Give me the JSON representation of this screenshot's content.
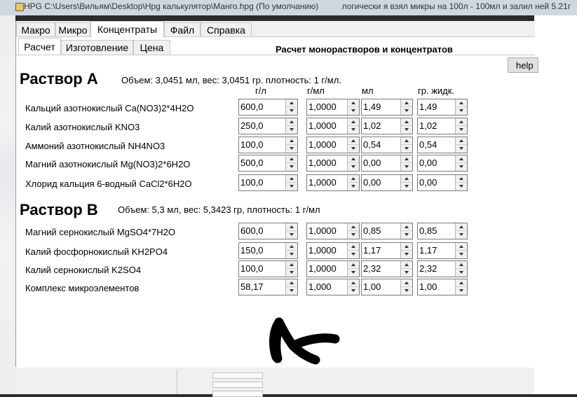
{
  "window_title": "HPG C:\\Users\\Вильям\\Desktop\\Hpg калькулятор\\Манго.hpg (По умолчанию)",
  "background_text": "логически я взял микры на 100л - 100мл и залил ней 5.21г",
  "menu": {
    "items": [
      "Макро",
      "Микро",
      "Концентраты",
      "Файл",
      "Справка"
    ],
    "active": 2
  },
  "subtabs": {
    "items": [
      "Расчет",
      "Изготовление",
      "Цена"
    ],
    "active": 0
  },
  "page_title": "Расчет монорастворов и концентратов",
  "help_label": "help",
  "columns": [
    "г/л",
    "г/мл",
    "мл",
    "гр. жидк."
  ],
  "solutions": [
    {
      "title": "Раствор А",
      "info": "Объем: 3,0451 мл, вес: 3,0451 гр. плотность: 1 г/мл.",
      "rows": [
        {
          "label": "Кальций азотнокислый Ca(NO3)2*4H2O",
          "values": [
            "600,0",
            "1,0000",
            "1,49",
            "1,49"
          ]
        },
        {
          "label": "Калий азотнокислый KNO3",
          "values": [
            "250,0",
            "1,0000",
            "1,02",
            "1,02"
          ]
        },
        {
          "label": "Аммоний азотнокислый NH4NO3",
          "values": [
            "100,0",
            "1,0000",
            "0,54",
            "0,54"
          ]
        },
        {
          "label": "Магний азотнокислый Mg(NO3)2*6H2O",
          "values": [
            "500,0",
            "1,0000",
            "0,00",
            "0,00"
          ]
        },
        {
          "label": "Хлорид кальция 6-водный CaCl2*6H2O",
          "values": [
            "100,0",
            "1,0000",
            "0,00",
            "0,00"
          ]
        }
      ]
    },
    {
      "title": "Раствор B",
      "info": "Объем: 5,3 мл, вес: 5,3423 гр, плотность: 1 г/мл",
      "rows": [
        {
          "label": "Магний сернокислый MgSO4*7H2O",
          "values": [
            "600,0",
            "1,0000",
            "0,85",
            "0,85"
          ]
        },
        {
          "label": "Калий фосфорнокислый KH2PO4",
          "values": [
            "150,0",
            "1,0000",
            "1,17",
            "1,17"
          ]
        },
        {
          "label": "Калий сернокислый K2SO4",
          "values": [
            "100,0",
            "1,0000",
            "2,32",
            "2,32"
          ]
        },
        {
          "label": "Комплекс микроэлементов",
          "values": [
            "58,17",
            "1,000",
            "1,00",
            "1,00"
          ]
        }
      ]
    }
  ]
}
